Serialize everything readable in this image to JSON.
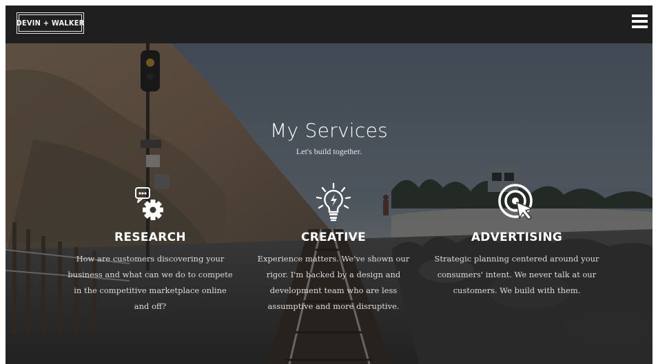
{
  "header": {
    "logo_text": "DEVIN + WALKER",
    "menu_icon": "hamburger-menu-icon"
  },
  "hero": {
    "title": "My Services",
    "subtitle": "Let's build together."
  },
  "services": [
    {
      "icon": "chat-gear-icon",
      "title": "RESEARCH",
      "description": "How are customers discovering your business and what can we do to compete in the competitive marketplace online and off?"
    },
    {
      "icon": "lightbulb-icon",
      "title": "CREATIVE",
      "description": "Experience matters. We've shown our rigor. I'm backed by a design and development team who are less assumptive and more disruptive."
    },
    {
      "icon": "target-cursor-icon",
      "title": "ADVERTISING",
      "description": "Strategic planning centered around your consumers' intent. We never talk at our customers. We build with them."
    }
  ],
  "colors": {
    "header_bg": "#1f1f1f",
    "text_primary": "#ffffff",
    "text_secondary": "#dcdcdc"
  }
}
